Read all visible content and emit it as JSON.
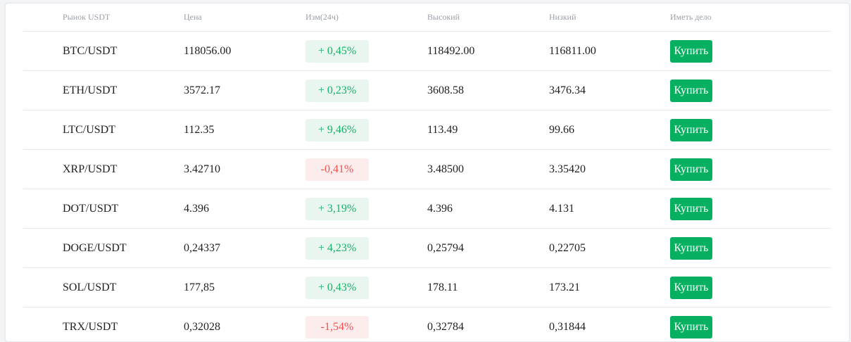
{
  "table": {
    "headers": {
      "pair": "Рынок USDT",
      "price": "Цена",
      "change": "Изм(24ч)",
      "high": "Высокий",
      "low": "Низкий",
      "action": "Иметь дело"
    },
    "rows": [
      {
        "pair": "BTC/USDT",
        "price": "118056.00",
        "change": "+ 0,45%",
        "direction": "up",
        "high": "118492.00",
        "low": "116811.00",
        "action": "Купить"
      },
      {
        "pair": "ETH/USDT",
        "price": "3572.17",
        "change": "+ 0,23%",
        "direction": "up",
        "high": "3608.58",
        "low": "3476.34",
        "action": "Купить"
      },
      {
        "pair": "LTC/USDT",
        "price": "112.35",
        "change": "+ 9,46%",
        "direction": "up",
        "high": "113.49",
        "low": "99.66",
        "action": "Купить"
      },
      {
        "pair": "XRP/USDT",
        "price": "3.42710",
        "change": "-0,41%",
        "direction": "down",
        "high": "3.48500",
        "low": "3.35420",
        "action": "Купить"
      },
      {
        "pair": "DOT/USDT",
        "price": "4.396",
        "change": "+ 3,19%",
        "direction": "up",
        "high": "4.396",
        "low": "4.131",
        "action": "Купить"
      },
      {
        "pair": "DOGE/USDT",
        "price": "0,24337",
        "change": "+ 4,23%",
        "direction": "up",
        "high": "0,25794",
        "low": "0,22705",
        "action": "Купить"
      },
      {
        "pair": "SOL/USDT",
        "price": "177,85",
        "change": "+ 0,43%",
        "direction": "up",
        "high": "178.11",
        "low": "173.21",
        "action": "Купить"
      },
      {
        "pair": "TRX/USDT",
        "price": "0,32028",
        "change": "-1,54%",
        "direction": "down",
        "high": "0,32784",
        "low": "0,31844",
        "action": "Купить"
      }
    ]
  },
  "colors": {
    "up_text": "#17b26a",
    "up_bg": "#e8f6ef",
    "down_text": "#f05252",
    "down_bg": "#fdecec",
    "buy_button": "#05b160"
  }
}
